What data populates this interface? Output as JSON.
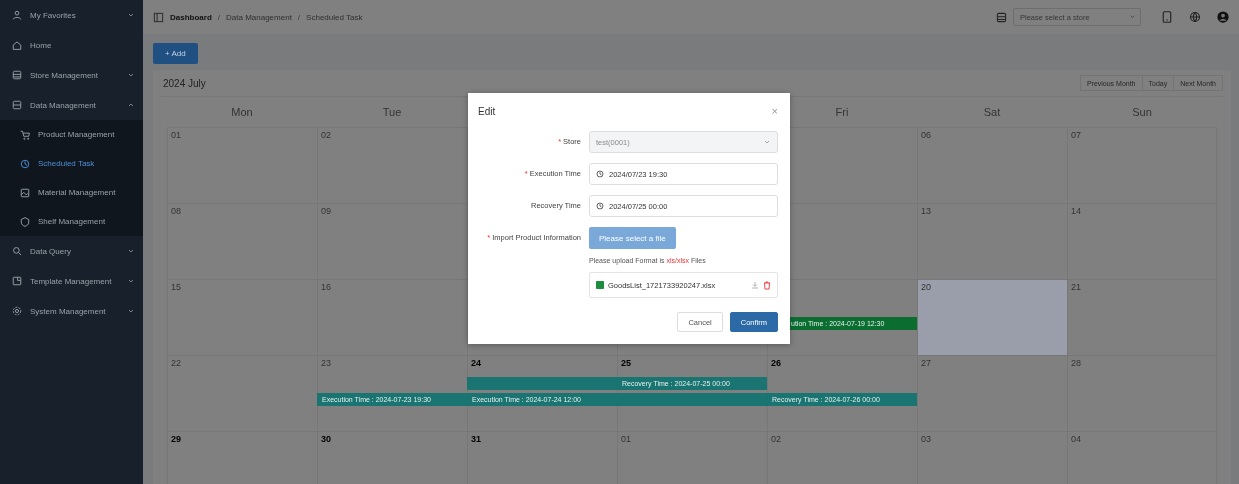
{
  "sidebar": {
    "items": [
      {
        "label": "My Favorites",
        "kind": "group",
        "expanded": false,
        "selected": false
      },
      {
        "label": "Home",
        "kind": "link",
        "selected": false
      },
      {
        "label": "Store Management",
        "kind": "group",
        "expanded": false,
        "selected": false
      },
      {
        "label": "Data Management",
        "kind": "group",
        "expanded": true,
        "selected": false,
        "children": [
          {
            "label": "Product Management",
            "selected": false
          },
          {
            "label": "Scheduled Task",
            "selected": true
          },
          {
            "label": "Material Management",
            "selected": false
          },
          {
            "label": "Shelf Management",
            "selected": false
          }
        ]
      },
      {
        "label": "Data Query",
        "kind": "group",
        "expanded": false,
        "selected": false
      },
      {
        "label": "Template Management",
        "kind": "group",
        "expanded": false,
        "selected": false
      },
      {
        "label": "System Management",
        "kind": "group",
        "expanded": false,
        "selected": false
      }
    ]
  },
  "breadcrumb": [
    {
      "kind": "link",
      "label": "Dashboard"
    },
    {
      "kind": "separator",
      "label": "/"
    },
    {
      "kind": "link",
      "label": "Data Management"
    },
    {
      "kind": "separator",
      "label": "/"
    },
    {
      "kind": "link",
      "label": "Scheduled Task"
    }
  ],
  "header": {
    "store_select": {
      "placeholder": "Please select a store"
    }
  },
  "toolbar": {
    "add_button": "+ Add"
  },
  "calendar": {
    "title": "2024 July",
    "nav_buttons": [
      "Previous Month",
      "Today",
      "Next Month"
    ],
    "weekdays": {
      "mon": "Mon",
      "tue": "Tue",
      "fri": "Fri",
      "sat": "Sat",
      "sun": "Sun"
    },
    "weeks": [
      {
        "days": {
          "mon": {
            "day": "01",
            "muted": true,
            "selected": false
          },
          "tue": {
            "day": "02",
            "muted": true,
            "selected": false
          },
          "sat": {
            "day": "06",
            "muted": true,
            "selected": false
          },
          "sun": {
            "day": "07",
            "muted": true,
            "selected": false
          }
        }
      },
      {
        "days": {
          "mon": {
            "day": "08",
            "muted": true,
            "selected": false
          },
          "tue": {
            "day": "09",
            "muted": true,
            "selected": false
          },
          "sat": {
            "day": "13",
            "muted": true,
            "selected": false
          },
          "sun": {
            "day": "14",
            "muted": true,
            "selected": false
          }
        }
      },
      {
        "days": {
          "mon": {
            "day": "15",
            "muted": true,
            "selected": false
          },
          "tue": {
            "day": "16",
            "muted": true,
            "selected": false
          },
          "fri": {
            "events": [
              {
                "kind": "lower",
                "color": "#0b6e30",
                "label": "ution Time : 2024-07-19 12:30"
              }
            ]
          },
          "sat": {
            "day": "20",
            "muted": true,
            "selected": true
          },
          "sun": {
            "day": "21",
            "muted": true,
            "selected": false
          }
        }
      },
      {
        "days": {
          "mon": {
            "day": "22",
            "muted": true,
            "selected": false
          },
          "tue": {
            "day": "23",
            "muted": true,
            "selected": false,
            "events": [
              {
                "kind": "lower",
                "color": "#1a7471",
                "label": "Execution Time : 2024-07-23 19:30"
              }
            ]
          },
          "wed": {
            "day": "24",
            "muted": false,
            "selected": false,
            "events": [
              {
                "kind": "upper",
                "color": "#1a7471"
              },
              {
                "kind": "lower",
                "color": "#1a7471",
                "label": "Execution Time : 2024-07-24 12:00"
              }
            ]
          },
          "thu": {
            "day": "25",
            "muted": false,
            "selected": false,
            "events": [
              {
                "kind": "upper",
                "color": "#1a7471",
                "label": "Recovery Time : 2024-07-25 00:00"
              },
              {
                "kind": "lower",
                "color": "#1a7471"
              }
            ]
          },
          "fri": {
            "day": "26",
            "muted": false,
            "selected": false,
            "events": [
              {
                "kind": "lower",
                "color": "#1a7471",
                "label": "Recovery Time : 2024-07-26 00:00"
              }
            ]
          },
          "sat": {
            "day": "27",
            "muted": true,
            "selected": false
          },
          "sun": {
            "day": "28",
            "muted": true,
            "selected": false
          }
        }
      },
      {
        "days": {
          "mon": {
            "day": "29",
            "muted": false,
            "selected": false
          },
          "tue": {
            "day": "30",
            "muted": false,
            "selected": false
          },
          "wed": {
            "day": "31",
            "muted": false,
            "selected": false
          },
          "thu": {
            "day": "01",
            "muted": true,
            "selected": false
          },
          "fri": {
            "day": "02",
            "muted": true,
            "selected": false
          },
          "sat": {
            "day": "03",
            "muted": true,
            "selected": false
          },
          "sun": {
            "day": "04",
            "muted": true,
            "selected": false
          }
        }
      }
    ]
  },
  "dialog": {
    "title": "Edit",
    "close": "×",
    "fields": [
      {
        "label": "Store",
        "required_mark": "*",
        "kind": "select",
        "value": "test(0001)",
        "disabled": true
      },
      {
        "label": "Execution Time",
        "required_mark": "*",
        "kind": "datetime",
        "value": "2024/07/23 19:30",
        "disabled": false
      },
      {
        "label": "Recovery Time",
        "kind": "datetime",
        "value": "2024/07/25 00:00",
        "disabled": false
      },
      {
        "label": "Import Product Information",
        "required_mark": "*",
        "kind": "upload",
        "button": "Please select a file",
        "hint": {
          "before": "Please upload Format is",
          "format": "xls/xlsx",
          "after": "Files"
        },
        "file": "GoodsList_1721733920247.xlsx"
      }
    ],
    "buttons": [
      {
        "label": "Cancel",
        "primary": false
      },
      {
        "label": "Confirm",
        "primary": true
      }
    ]
  }
}
